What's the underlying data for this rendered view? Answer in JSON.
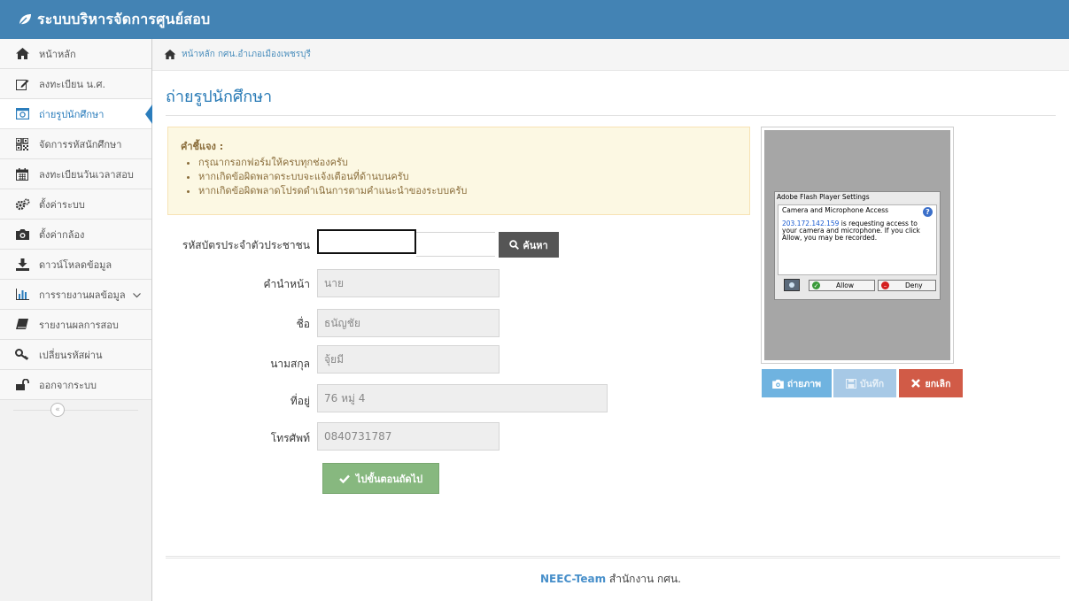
{
  "app": {
    "title": "ระบบบริหารจัดการศูนย์สอบ"
  },
  "sidebar": {
    "items": [
      {
        "label": "หน้าหลัก",
        "icon": "home-icon"
      },
      {
        "label": "ลงทะเบียน น.ศ.",
        "icon": "edit-icon"
      },
      {
        "label": "ถ่ายรูปนักศึกษา",
        "icon": "camera-icon"
      },
      {
        "label": "จัดการรหัสนักศึกษา",
        "icon": "qrcode-icon"
      },
      {
        "label": "ลงทะเบียนวันเวลาสอบ",
        "icon": "calendar-icon"
      },
      {
        "label": "ตั้งค่าระบบ",
        "icon": "cogs-icon"
      },
      {
        "label": "ตั้งค่ากล้อง",
        "icon": "camera-icon"
      },
      {
        "label": "ดาวน์โหลดข้อมูล",
        "icon": "download-icon"
      },
      {
        "label": "การรายงานผลข้อมูล",
        "icon": "bar-chart-icon"
      },
      {
        "label": "รายงานผลการสอบ",
        "icon": "book-icon"
      },
      {
        "label": "เปลี่ยนรหัสผ่าน",
        "icon": "key-icon"
      },
      {
        "label": "ออกจากระบบ",
        "icon": "unlock-icon"
      }
    ],
    "active_index": 2,
    "collapse_symbol": "«"
  },
  "breadcrumb": {
    "text": "หน้าหลัก กศน.อำเภอเมืองเพชรบุรี"
  },
  "page": {
    "title": "ถ่ายรูปนักศึกษา"
  },
  "alert": {
    "title": "คำชี้แจง :",
    "items": [
      "กรุณากรอกฟอร์มให้ครบทุกช่องครับ",
      "หากเกิดข้อผิดพลาดระบบจะแจ้งเตือนที่ด้านบนครับ",
      "หากเกิดข้อผิดพลาดโปรดดำเนินการตามคำแนะนำของระบบครับ"
    ]
  },
  "form": {
    "id_label": "รหัสบัตรประจำตัวประชาชน",
    "id_value": "",
    "search_label": "ค้นหา",
    "prefix_label": "คำนำหน้า",
    "prefix_value": "นาย",
    "firstname_label": "ชื่อ",
    "firstname_value": "ธนัญชัย",
    "lastname_label": "นามสกุล",
    "lastname_value": "จุ้ยมี",
    "address_label": "ที่อยู่",
    "address_value": "76 หมู่ 4",
    "phone_label": "โทรศัพท์",
    "phone_value": "0840731787",
    "next_label": "ไปขั้นตอนถัดไป"
  },
  "flash": {
    "title": "Adobe Flash Player Settings",
    "heading": "Camera and Microphone Access",
    "ip": "203.172.142.159",
    "message": " is requesting access to your camera and microphone. If you click Allow, you may be recorded.",
    "allow_label": "Allow",
    "deny_label": "Deny"
  },
  "camera": {
    "shot_label": "ถ่ายภาพ",
    "save_label": "บันทึก",
    "cancel_label": "ยกเลิก"
  },
  "footer": {
    "team": "NEEC-Team",
    "org": " สำนักงาน กศน."
  },
  "colors": {
    "navbar": "#4383b4",
    "accent": "#2679b5",
    "success": "#87b87f",
    "danger": "#d15b47",
    "info": "#6fb3e0"
  }
}
